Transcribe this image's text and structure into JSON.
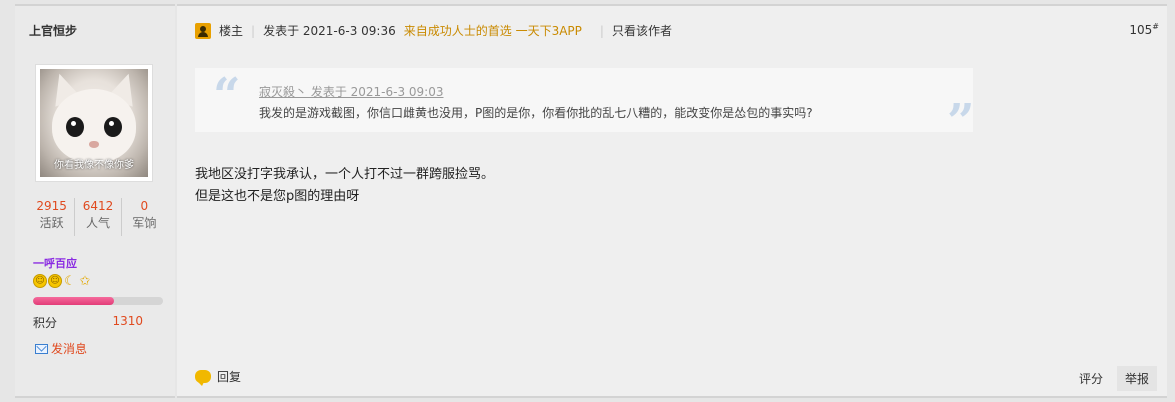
{
  "user": {
    "name": "上官恒步",
    "avatar_caption": "你看我像不像你爹",
    "stats": [
      {
        "value": "2915",
        "label": "活跃"
      },
      {
        "value": "6412",
        "label": "人气"
      },
      {
        "value": "0",
        "label": "军饷"
      }
    ],
    "group_title": "一呼百应",
    "medals": [
      "smile-medal-icon",
      "smile-medal-icon",
      "moon-medal-icon",
      "star-medal-icon"
    ],
    "progress_fraction": 0.62,
    "points_label": "积分",
    "points_value": "1310",
    "send_message_label": "发消息"
  },
  "post": {
    "owner_label": "楼主",
    "posted_at": "发表于 2021-6-3 09:36",
    "promo": "来自成功人士的首选 一天下3APP",
    "only_author_label": "只看该作者",
    "floor_number": "105",
    "floor_suffix": "#",
    "quote": {
      "meta": "寂灭殺丶 发表于 2021-6-3 09:03",
      "text": "我发的是游戏截图，你信口雌黄也没用，P图的是你，你看你批的乱七八糟的，能改变你是怂包的事实吗?"
    },
    "body_lines": [
      "我地区没打字我承认，一个人打不过一群跨服捡骂。",
      "但是这也不是您p图的理由呀"
    ],
    "reply_label": "回复",
    "rate_label": "评分",
    "report_label": "举报"
  },
  "colors": {
    "accent_red": "#e04a1f",
    "group_purple": "#8a2be2",
    "promo_gold": "#c98a00"
  }
}
